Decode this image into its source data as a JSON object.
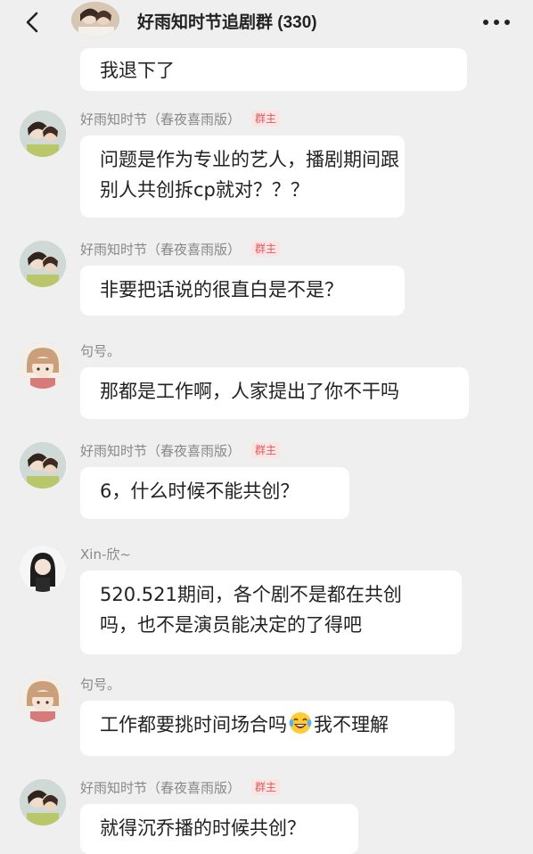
{
  "header": {
    "title": "好雨知时节追剧群 (330)",
    "back_icon": "chevron-left-icon",
    "more_icon": "more-dots-icon"
  },
  "messages": [
    {
      "text": "我退下了"
    },
    {
      "sender": "好雨知时节（春夜喜雨版）",
      "badge": "群主",
      "lines": [
        "问题是作为专业的艺人，播剧期间跟",
        "别人共创拆cp就对？？？"
      ]
    },
    {
      "sender": "好雨知时节（春夜喜雨版）",
      "badge": "群主",
      "text": "非要把话说的很直白是不是？"
    },
    {
      "sender": "句号。",
      "text": "那都是工作啊，人家提出了你不干吗"
    },
    {
      "sender": "好雨知时节（春夜喜雨版）",
      "badge": "群主",
      "text": "6，什么时候不能共创？"
    },
    {
      "sender": "Xin-欣~",
      "lines": [
        "520.521期间，各个剧不是都在共创",
        "吗，也不是演员能决定的了得吧"
      ]
    },
    {
      "sender": "句号。",
      "text_before": "工作都要挑时间场合吗",
      "text_after": "我不理解",
      "emoji": "laughing-tears-emoji"
    },
    {
      "sender": "好雨知时节（春夜喜雨版）",
      "badge": "群主",
      "text": "就得沉乔播的时候共创？"
    }
  ]
}
